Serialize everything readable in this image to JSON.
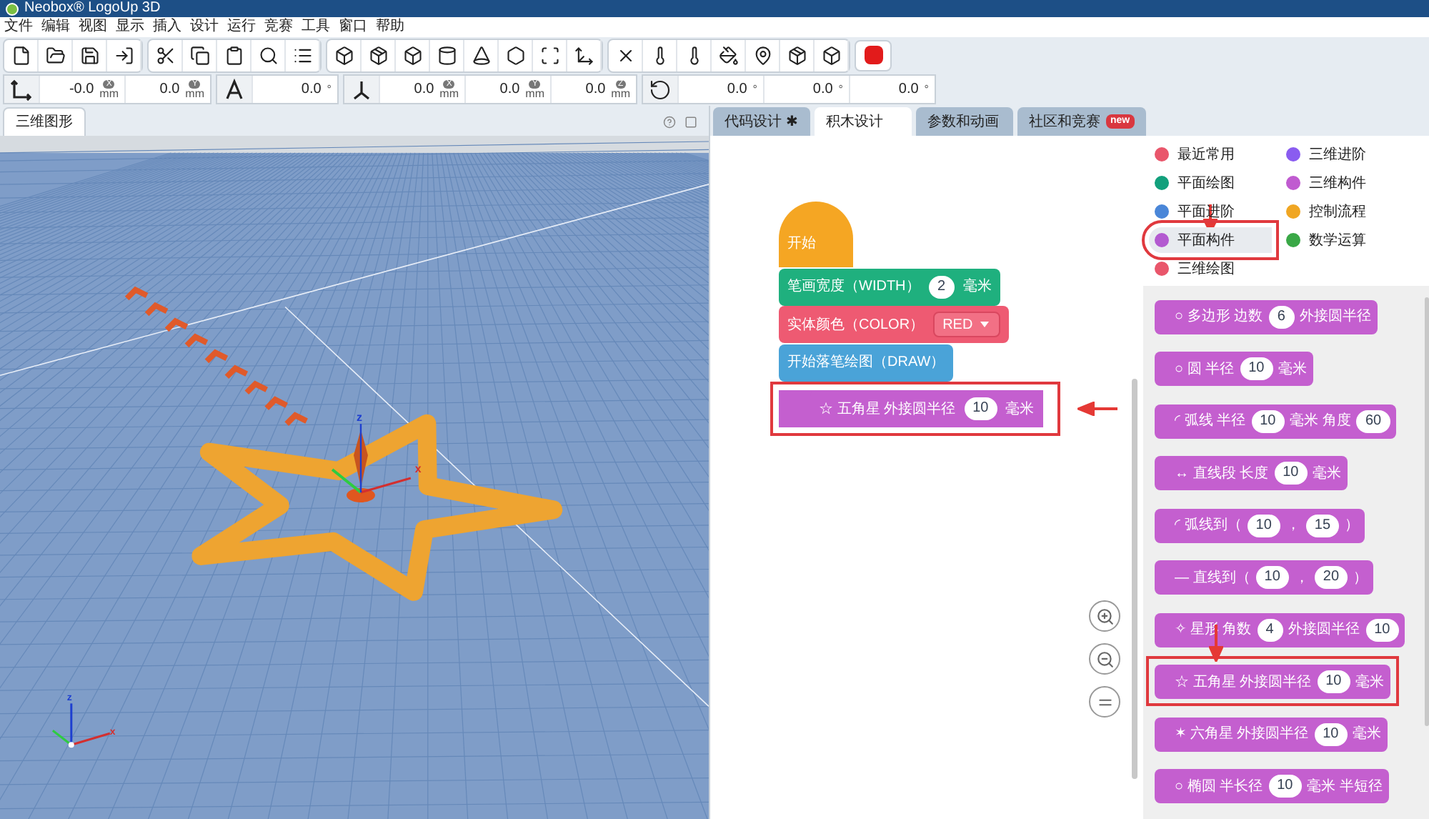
{
  "window": {
    "title": "Neobox® LogoUp 3D"
  },
  "menu": [
    "文件",
    "编辑",
    "视图",
    "显示",
    "插入",
    "设计",
    "运行",
    "竞赛",
    "工具",
    "窗口",
    "帮助"
  ],
  "transform_bar": [
    {
      "kind": "position",
      "fields": [
        {
          "value": "-0.0",
          "unit": "mm",
          "axis": "X"
        },
        {
          "value": "0.0",
          "unit": "mm",
          "axis": "Y"
        }
      ]
    },
    {
      "kind": "heading",
      "fields": [
        {
          "value": "0.0",
          "unit": "°"
        }
      ]
    },
    {
      "kind": "axes",
      "fields": [
        {
          "value": "0.0",
          "unit": "mm",
          "axis": "X"
        },
        {
          "value": "0.0",
          "unit": "mm",
          "axis": "Y"
        },
        {
          "value": "0.0",
          "unit": "mm",
          "axis": "Z"
        }
      ]
    },
    {
      "kind": "rotation",
      "fields": [
        {
          "value": "0.0",
          "unit": "°"
        },
        {
          "value": "0.0",
          "unit": "°"
        },
        {
          "value": "0.0",
          "unit": "°"
        }
      ]
    }
  ],
  "view_tabs": [
    {
      "label": "三维图形",
      "selected": true
    }
  ],
  "viewport": {
    "gizmo_axes": [
      "z",
      "x"
    ],
    "corner_axes": [
      "z",
      "x"
    ]
  },
  "editor_tabs": [
    {
      "label": "代码设计 ✱",
      "selected": false
    },
    {
      "label": "积木设计",
      "selected": true
    },
    {
      "label": "参数和动画",
      "selected": false
    },
    {
      "label": "社区和竞赛",
      "selected": false,
      "badge": "new"
    }
  ],
  "workspace_blocks": [
    {
      "kind": "hat",
      "color": "#f5a623",
      "highlighted": false,
      "parts": [
        {
          "kind": "text",
          "text": "开始"
        }
      ]
    },
    {
      "kind": "stack",
      "color": "#1fb07e",
      "highlighted": false,
      "parts": [
        {
          "kind": "text",
          "text": "笔画宽度（WIDTH）"
        },
        {
          "kind": "field",
          "text": "2"
        },
        {
          "kind": "text",
          "text": "毫米"
        }
      ]
    },
    {
      "kind": "stack",
      "color": "#ee5a72",
      "highlighted": false,
      "parts": [
        {
          "kind": "text",
          "text": "实体颜色（COLOR）"
        },
        {
          "kind": "dropdown",
          "text": "RED"
        }
      ]
    },
    {
      "kind": "stack",
      "color": "#4aa3d8",
      "highlighted": false,
      "parts": [
        {
          "kind": "text",
          "text": "开始落笔绘图（DRAW）"
        }
      ]
    },
    {
      "kind": "stack",
      "color": "#c45fcf",
      "highlighted": true,
      "parts": [
        {
          "kind": "text",
          "text": "☆ 五角星 外接圆半径"
        },
        {
          "kind": "field",
          "text": "10"
        },
        {
          "kind": "text",
          "text": "毫米"
        }
      ]
    }
  ],
  "categories": [
    {
      "label": "最近常用",
      "color": "#e9566b",
      "selected": false
    },
    {
      "label": "三维进阶",
      "color": "#8a5cf0",
      "selected": false
    },
    {
      "label": "平面绘图",
      "color": "#12a07c",
      "selected": false
    },
    {
      "label": "三维构件",
      "color": "#c05bd0",
      "selected": false
    },
    {
      "label": "平面进阶",
      "color": "#4a86d8",
      "selected": false
    },
    {
      "label": "控制流程",
      "color": "#f0a623",
      "selected": false
    },
    {
      "label": "平面构件",
      "color": "#b35ad0",
      "selected": true
    },
    {
      "label": "数学运算",
      "color": "#3aa847",
      "selected": false
    },
    {
      "label": "三维绘图",
      "color": "#e9566b",
      "selected": false
    }
  ],
  "flyout_blocks": [
    {
      "highlighted": false,
      "parts": [
        {
          "kind": "text",
          "text": "○ 多边形 边数"
        },
        {
          "kind": "field",
          "text": "6"
        },
        {
          "kind": "text",
          "text": "外接圆半径"
        }
      ]
    },
    {
      "highlighted": false,
      "parts": [
        {
          "kind": "text",
          "text": "○ 圆 半径"
        },
        {
          "kind": "field",
          "text": "10"
        },
        {
          "kind": "text",
          "text": "毫米"
        }
      ]
    },
    {
      "highlighted": false,
      "parts": [
        {
          "kind": "text",
          "text": "◜ 弧线 半径"
        },
        {
          "kind": "field",
          "text": "10"
        },
        {
          "kind": "text",
          "text": "毫米 角度"
        },
        {
          "kind": "field",
          "text": "60"
        }
      ]
    },
    {
      "highlighted": false,
      "parts": [
        {
          "kind": "text",
          "text": "↔ 直线段 长度"
        },
        {
          "kind": "field",
          "text": "10"
        },
        {
          "kind": "text",
          "text": "毫米"
        }
      ]
    },
    {
      "highlighted": false,
      "parts": [
        {
          "kind": "text",
          "text": "◜ 弧线到（"
        },
        {
          "kind": "field",
          "text": "10"
        },
        {
          "kind": "text",
          "text": "，"
        },
        {
          "kind": "field",
          "text": "15"
        },
        {
          "kind": "text",
          "text": "）"
        }
      ]
    },
    {
      "highlighted": false,
      "parts": [
        {
          "kind": "text",
          "text": "— 直线到（"
        },
        {
          "kind": "field",
          "text": "10"
        },
        {
          "kind": "text",
          "text": "，"
        },
        {
          "kind": "field",
          "text": "20"
        },
        {
          "kind": "text",
          "text": "）"
        }
      ]
    },
    {
      "highlighted": false,
      "parts": [
        {
          "kind": "text",
          "text": "✧ 星形 角数"
        },
        {
          "kind": "field",
          "text": "4"
        },
        {
          "kind": "text",
          "text": "外接圆半径"
        },
        {
          "kind": "field",
          "text": "10"
        }
      ]
    },
    {
      "highlighted": true,
      "parts": [
        {
          "kind": "text",
          "text": "☆ 五角星 外接圆半径"
        },
        {
          "kind": "field",
          "text": "10"
        },
        {
          "kind": "text",
          "text": "毫米"
        }
      ]
    },
    {
      "highlighted": false,
      "parts": [
        {
          "kind": "text",
          "text": "✶ 六角星 外接圆半径"
        },
        {
          "kind": "field",
          "text": "10"
        },
        {
          "kind": "text",
          "text": "毫米"
        }
      ]
    },
    {
      "highlighted": false,
      "parts": [
        {
          "kind": "text",
          "text": "○ 椭圆 半长径"
        },
        {
          "kind": "field",
          "text": "10"
        },
        {
          "kind": "text",
          "text": "毫米 半短径"
        }
      ]
    }
  ]
}
